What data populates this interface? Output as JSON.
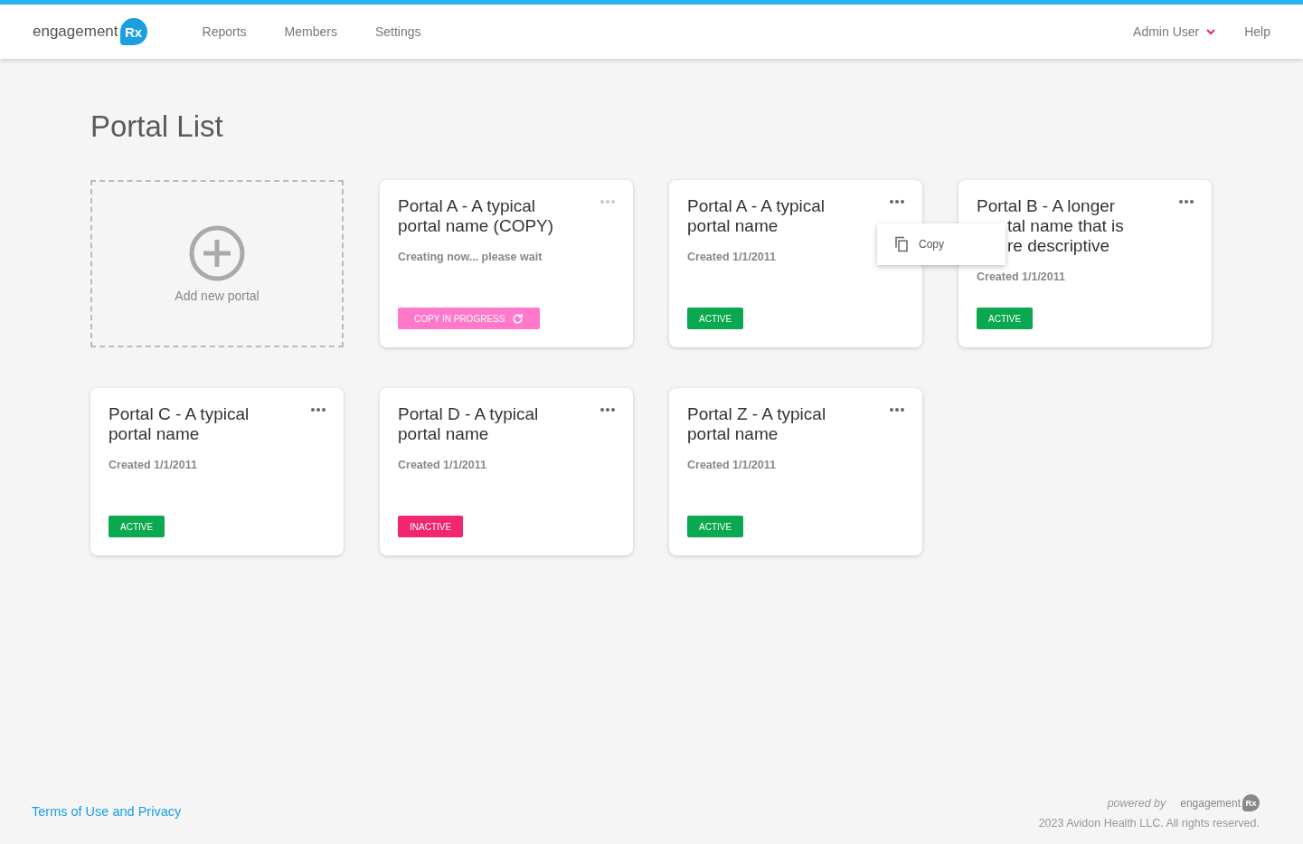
{
  "header": {
    "logo": {
      "word": "engagement",
      "mark": "Rx"
    },
    "nav": [
      {
        "label": "Reports"
      },
      {
        "label": "Members"
      },
      {
        "label": "Settings"
      }
    ],
    "user": "Admin User",
    "help": "Help"
  },
  "page_title": "Portal List",
  "add_card": {
    "label": "Add new portal"
  },
  "cards": [
    {
      "title_lines": [
        "Portal A - A typical",
        "portal name (COPY)"
      ],
      "subtitle": "Creating now... please wait",
      "status": {
        "kind": "copying",
        "label": "COPY IN PROGRESS"
      },
      "actions_disabled": true,
      "covered_by_menu": false
    },
    {
      "title_lines": [
        "Portal A - A typical",
        "portal name"
      ],
      "subtitle": "Created 1/1/2011",
      "status": {
        "kind": "active",
        "label": "ACTIVE"
      },
      "actions_disabled": false,
      "covered_by_menu": false,
      "menu": {
        "items": [
          {
            "label": "Copy"
          }
        ]
      }
    },
    {
      "title_lines": [
        "Portal B - A longer",
        "tal name that is",
        "re descriptive"
      ],
      "subtitle": "Created 1/1/2011",
      "status": {
        "kind": "active",
        "label": "ACTIVE"
      },
      "actions_disabled": false,
      "covered_by_menu": true
    },
    {
      "title_lines": [
        "Portal C - A typical",
        "portal name"
      ],
      "subtitle": "Created 1/1/2011",
      "status": {
        "kind": "active",
        "label": "ACTIVE"
      },
      "actions_disabled": false,
      "covered_by_menu": false
    },
    {
      "title_lines": [
        "Portal D - A typical",
        "portal name"
      ],
      "subtitle": "Created 1/1/2011",
      "status": {
        "kind": "inactive",
        "label": "INACTIVE"
      },
      "actions_disabled": false,
      "covered_by_menu": false
    },
    {
      "title_lines": [
        "Portal Z - A typical",
        "portal name"
      ],
      "subtitle": "Created 1/1/2011",
      "status": {
        "kind": "active",
        "label": "ACTIVE"
      },
      "actions_disabled": false,
      "covered_by_menu": false
    }
  ],
  "footer": {
    "link": "Terms of Use and Privacy",
    "powered_by": "powered by",
    "logo": {
      "word": "engagement",
      "mark": "Rx"
    },
    "copyright": "2023 Avidon Health LLC. All rights reserved."
  }
}
